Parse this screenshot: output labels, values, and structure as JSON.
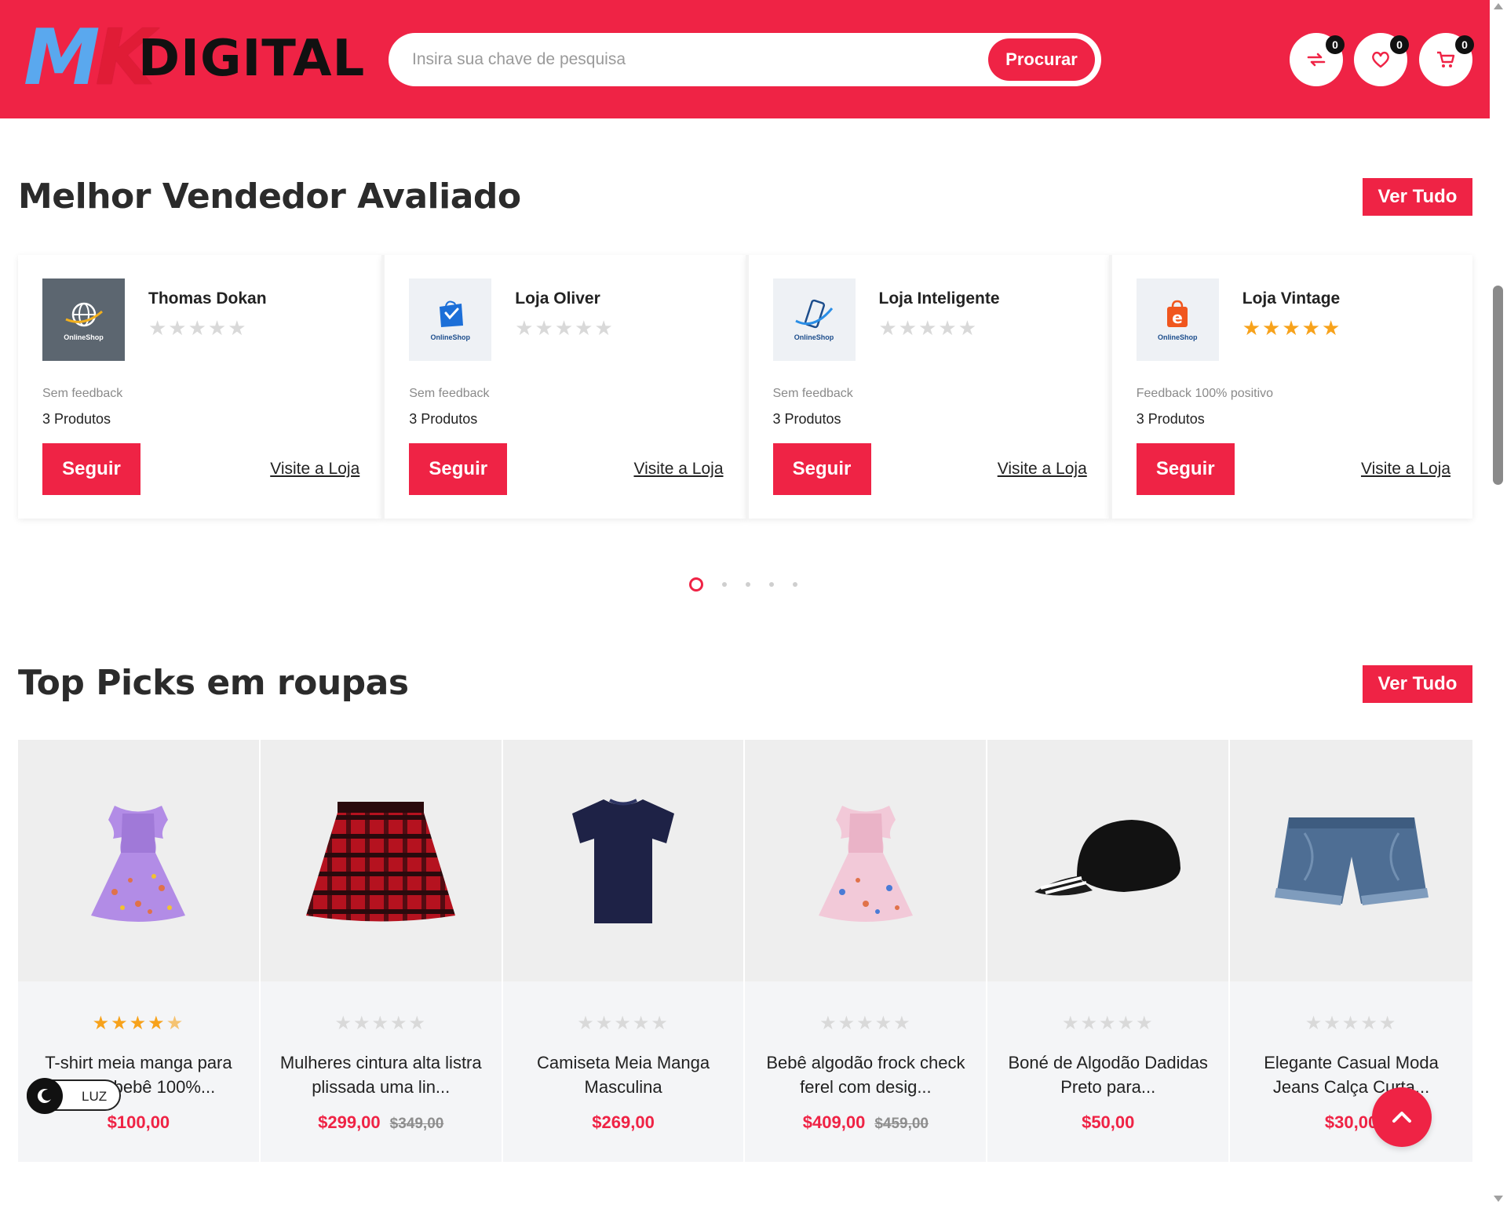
{
  "header": {
    "logo": {
      "mk_m": "M",
      "mk_k": "K",
      "word": "DIGITAL"
    },
    "search": {
      "placeholder": "Insira sua chave de pesquisa",
      "button_label": "Procurar"
    },
    "icons": [
      {
        "name": "compare-icon",
        "count": "0"
      },
      {
        "name": "wishlist-heart-icon",
        "count": "0"
      },
      {
        "name": "cart-icon",
        "count": "0"
      }
    ],
    "colors": {
      "brand": "#ef2345",
      "logo_m": "#5aa8ee",
      "logo_k": "#e01c36"
    }
  },
  "sellers_section": {
    "title": "Melhor Vendedor Avaliado",
    "view_all": "Ver Tudo",
    "sellers": [
      {
        "name": "Thomas Dokan",
        "rating": 0,
        "feedback": "Sem feedback",
        "products": "3 Produtos",
        "follow": "Seguir",
        "visit": "Visite a Loja",
        "logo_text": "OnlineShop",
        "logo_icon": "globe-cart-icon"
      },
      {
        "name": "Loja Oliver",
        "rating": 0,
        "feedback": "Sem feedback",
        "products": "3 Produtos",
        "follow": "Seguir",
        "visit": "Visite a Loja",
        "logo_text": "OnlineShop",
        "logo_icon": "shopping-bag-check-icon"
      },
      {
        "name": "Loja Inteligente",
        "rating": 0,
        "feedback": "Sem feedback",
        "products": "3 Produtos",
        "follow": "Seguir",
        "visit": "Visite a Loja",
        "logo_text": "OnlineShop",
        "logo_icon": "smartphone-orbit-icon"
      },
      {
        "name": "Loja Vintage",
        "rating": 5,
        "feedback": "Feedback 100% positivo",
        "products": "3 Produtos",
        "follow": "Seguir",
        "visit": "Visite a Loja",
        "logo_text": "OnlineShop",
        "logo_icon": "e-bag-icon"
      }
    ],
    "carousel": {
      "pages": 5,
      "active_page": 1
    }
  },
  "products_section": {
    "title": "Top Picks em roupas",
    "view_all": "Ver Tudo",
    "products": [
      {
        "name": "T-shirt meia manga para bebês bebê 100%...",
        "rating": 4.5,
        "price": "$100,00",
        "old_price": "",
        "image": "purple-butterfly-dress-image"
      },
      {
        "name": "Mulheres cintura alta listra plissada uma lin...",
        "rating": 0,
        "price": "$299,00",
        "old_price": "$349,00",
        "image": "red-plaid-skirt-image"
      },
      {
        "name": "Camiseta Meia Manga Masculina",
        "rating": 0,
        "price": "$269,00",
        "old_price": "",
        "image": "navy-tshirt-image"
      },
      {
        "name": "Bebê algodão frock check ferel com desig...",
        "rating": 0,
        "price": "$409,00",
        "old_price": "$459,00",
        "image": "pink-butterfly-dress-image"
      },
      {
        "name": "Boné de Algodão Dadidas Preto para...",
        "rating": 0,
        "price": "$50,00",
        "old_price": "",
        "image": "black-cap-image"
      },
      {
        "name": "Elegante Casual Moda Jeans Calça Curta...",
        "rating": 0,
        "price": "$30,00",
        "old_price": "",
        "image": "denim-shorts-image"
      }
    ]
  },
  "floating": {
    "theme_toggle_label": "LUZ",
    "back_to_top": "chevron-up-icon"
  }
}
